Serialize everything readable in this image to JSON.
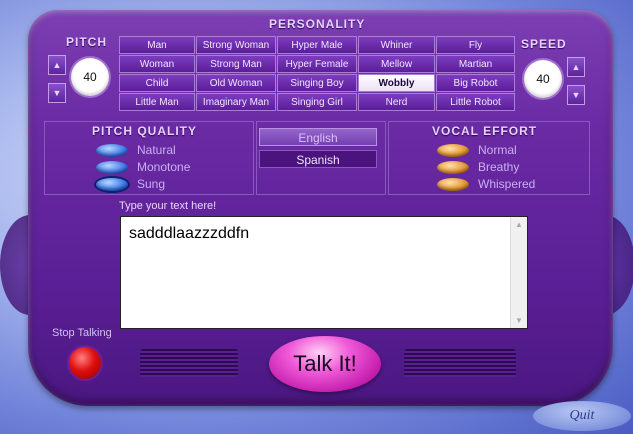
{
  "personality": {
    "title": "PERSONALITY",
    "voices": [
      [
        "Man",
        "Strong Woman",
        "Hyper Male",
        "Whiner",
        "Fly"
      ],
      [
        "Woman",
        "Strong Man",
        "Hyper Female",
        "Mellow",
        "Martian"
      ],
      [
        "Child",
        "Old Woman",
        "Singing Boy",
        "Wobbly",
        "Big Robot"
      ],
      [
        "Little Man",
        "Imaginary Man",
        "Singing Girl",
        "Nerd",
        "Little Robot"
      ]
    ],
    "selected": "Wobbly"
  },
  "pitch": {
    "title": "PITCH",
    "value": "40",
    "up_icon": "triangle-up-icon",
    "down_icon": "triangle-down-icon"
  },
  "speed": {
    "title": "SPEED",
    "value": "40",
    "up_icon": "triangle-up-icon",
    "down_icon": "triangle-down-icon"
  },
  "pitch_quality": {
    "title": "PITCH QUALITY",
    "options": [
      "Natural",
      "Monotone",
      "Sung"
    ],
    "selected": "Sung"
  },
  "language": {
    "options": [
      "English",
      "Spanish"
    ],
    "selected": "Spanish"
  },
  "vocal_effort": {
    "title": "VOCAL EFFORT",
    "options": [
      "Normal",
      "Breathy",
      "Whispered"
    ]
  },
  "text_input": {
    "label": "Type your text here!",
    "value": "sadddlaazzzddfn"
  },
  "controls": {
    "stop_label": "Stop Talking",
    "talk_label": "Talk It!",
    "quit_label": "Quit"
  },
  "colors": {
    "panel": "#6a2aa3",
    "talk_button": "#f05ad8",
    "stop_button": "#e01010",
    "quit_button": "#7d92dc",
    "blue_radio": "#3a76e8",
    "orange_radio": "#e2952e"
  }
}
